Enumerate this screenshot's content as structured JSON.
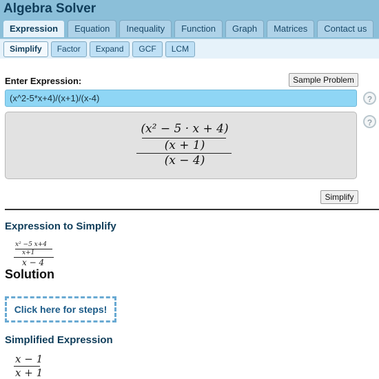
{
  "app": {
    "title": "Algebra Solver"
  },
  "tabs": [
    {
      "label": "Expression",
      "active": true
    },
    {
      "label": "Equation",
      "active": false
    },
    {
      "label": "Inequality",
      "active": false
    },
    {
      "label": "Function",
      "active": false
    },
    {
      "label": "Graph",
      "active": false
    },
    {
      "label": "Matrices",
      "active": false
    },
    {
      "label": "Contact us",
      "active": false
    }
  ],
  "subtabs": [
    {
      "label": "Simplify",
      "active": true
    },
    {
      "label": "Factor",
      "active": false
    },
    {
      "label": "Expand",
      "active": false
    },
    {
      "label": "GCF",
      "active": false
    },
    {
      "label": "LCM",
      "active": false
    }
  ],
  "input": {
    "label": "Enter Expression:",
    "value": "(x^2-5*x+4)/(x+1)/(x-4)",
    "sample_button": "Sample Problem",
    "help_icon": "?"
  },
  "preview": {
    "numerator_top": "(x² − 5 · x + 4)",
    "numerator_bottom": "(x + 1)",
    "denominator": "(x − 4)"
  },
  "actions": {
    "simplify_button": "Simplify"
  },
  "results": {
    "expression_heading": "Expression to Simplify",
    "expr_small_top": "x² −5 x+4",
    "expr_small_mid": "x+1",
    "expr_small_bottom": "x − 4",
    "solution_heading": "Solution",
    "steps_link": "Click here for steps!",
    "simplified_heading": "Simplified Expression",
    "simplified_numerator": "x − 1",
    "simplified_denominator": "x + 1"
  },
  "colors": {
    "header_bg": "#8bbfd9",
    "input_bg": "#8fd6f5",
    "heading": "#0f3d5a",
    "steps_border": "#6aaad3"
  },
  "icons": {
    "help": "help-circle-icon"
  }
}
